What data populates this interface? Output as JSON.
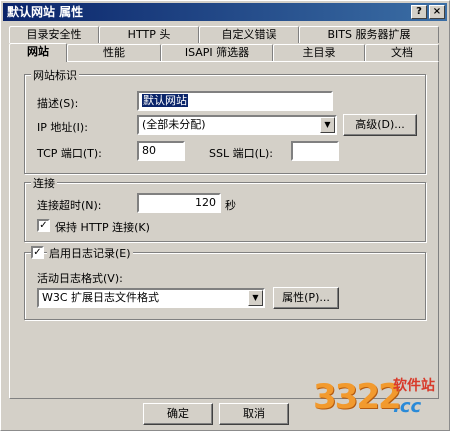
{
  "window": {
    "title": "默认网站  属性",
    "help_btn": "?",
    "close_btn": "×"
  },
  "tabs": {
    "row1": [
      "目录安全性",
      "HTTP 头",
      "自定义错误",
      "BITS 服务器扩展"
    ],
    "row2": [
      "网站",
      "性能",
      "ISAPI 筛选器",
      "主目录",
      "文档"
    ]
  },
  "site_group": {
    "legend": "网站标识",
    "desc_label": "描述(S):",
    "desc_value": "默认网站",
    "ip_label": "IP 地址(I):",
    "ip_value": "(全部未分配)",
    "advanced_btn": "高级(D)...",
    "tcp_label": "TCP 端口(T):",
    "tcp_value": "80",
    "ssl_label": "SSL 端口(L):",
    "ssl_value": ""
  },
  "conn_group": {
    "legend": "连接",
    "timeout_label": "连接超时(N):",
    "timeout_value": "120",
    "timeout_unit": "秒",
    "keepalive_label": "保持 HTTP 连接(K)",
    "keepalive_checked": true
  },
  "log_group": {
    "enable_label": "启用日志记录(E)",
    "enable_checked": true,
    "format_label": "活动日志格式(V):",
    "format_value": "W3C 扩展日志文件格式",
    "props_btn": "属性(P)..."
  },
  "footer": {
    "ok": "确定",
    "cancel": "取消"
  },
  "watermark": {
    "number": "3322",
    "site": "软件站",
    "domain": ".cc"
  },
  "colors": {
    "face": "#d4d0c8",
    "title_start": "#0a246a",
    "title_end": "#3b6ea5",
    "selection": "#0a246a"
  }
}
